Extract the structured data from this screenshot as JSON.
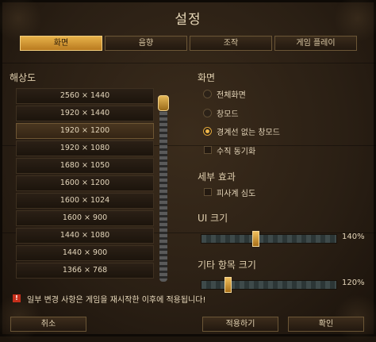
{
  "title": "설정",
  "tabs": [
    {
      "label": "화면",
      "active": true
    },
    {
      "label": "음향",
      "active": false
    },
    {
      "label": "조작",
      "active": false
    },
    {
      "label": "게임 플레이",
      "active": false
    }
  ],
  "resolution": {
    "heading": "해상도",
    "items": [
      "2560 × 1440",
      "1920 × 1440",
      "1920 × 1200",
      "1920 × 1080",
      "1680 × 1050",
      "1600 × 1200",
      "1600 × 1024",
      "1600 × 900",
      "1440 × 1080",
      "1440 × 900",
      "1366 × 768"
    ],
    "selected": "1920 × 1200"
  },
  "display": {
    "heading": "화면",
    "options": [
      {
        "label": "전체화면",
        "selected": false
      },
      {
        "label": "창모드",
        "selected": false
      },
      {
        "label": "경계선 없는 창모드",
        "selected": true
      }
    ],
    "vsync_label": "수직 동기화",
    "vsync_checked": false
  },
  "effects": {
    "heading": "세부 효과",
    "blood_label": "피사계 심도",
    "blood_checked": false
  },
  "ui_scale": {
    "heading": "UI 크기",
    "value_text": "140%",
    "fraction": 0.4
  },
  "other_scale": {
    "heading": "기타 항목 크기",
    "value_text": "120%",
    "fraction": 0.2
  },
  "warning": {
    "icon": "!",
    "text": "일부 변경 사항은 게임을 재시작한 이후에 적용됩니다!"
  },
  "buttons": {
    "cancel": "취소",
    "apply": "적용하기",
    "confirm": "확인"
  },
  "colors": {
    "accent": "#e7b24a",
    "warning": "#c62f1b"
  }
}
